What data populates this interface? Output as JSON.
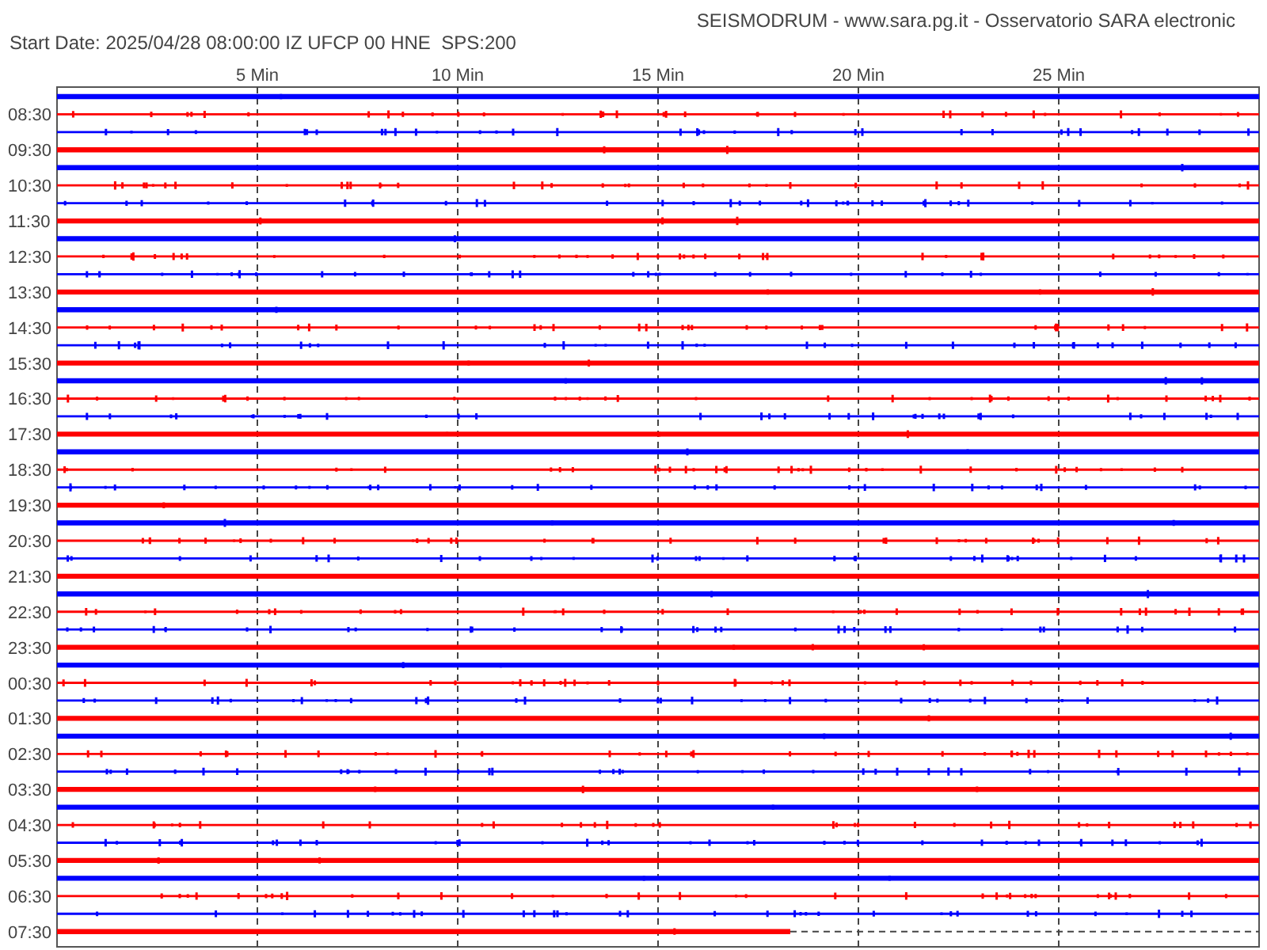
{
  "header": {
    "title": "SEISMODRUM - www.sara.pg.it - Osservatorio SARA electronic",
    "start_info": "Start Date: 2025/04/28 08:00:00 IZ UFCP 00 HNE  SPS:200"
  },
  "x_ticks": [
    "5 Min",
    "10 Min",
    "15 Min",
    "20 Min",
    "25 Min"
  ],
  "traces": [
    {
      "color": "#0000ff",
      "kind": "quiet",
      "level": 1
    },
    {
      "label": "08:30",
      "color": "#ff0000",
      "kind": "noisy",
      "level": 1
    },
    {
      "color": "#0000ff",
      "kind": "noisy",
      "level": 1
    },
    {
      "label": "09:30",
      "color": "#ff0000",
      "kind": "quiet",
      "level": 1
    },
    {
      "color": "#0000ff",
      "kind": "quiet",
      "level": 1
    },
    {
      "label": "10:30",
      "color": "#ff0000",
      "kind": "noisy",
      "level": 1
    },
    {
      "color": "#0000ff",
      "kind": "noisy",
      "level": 1
    },
    {
      "label": "11:30",
      "color": "#ff0000",
      "kind": "quiet",
      "level": 1
    },
    {
      "color": "#0000ff",
      "kind": "quiet",
      "level": 1
    },
    {
      "label": "12:30",
      "color": "#ff0000",
      "kind": "noisy",
      "level": 1
    },
    {
      "color": "#0000ff",
      "kind": "noisy",
      "level": 1
    },
    {
      "label": "13:30",
      "color": "#ff0000",
      "kind": "quiet",
      "level": 1
    },
    {
      "color": "#0000ff",
      "kind": "quiet",
      "level": 1
    },
    {
      "label": "14:30",
      "color": "#ff0000",
      "kind": "noisy",
      "level": 1
    },
    {
      "color": "#0000ff",
      "kind": "noisy",
      "level": 1
    },
    {
      "label": "15:30",
      "color": "#ff0000",
      "kind": "quiet",
      "level": 1
    },
    {
      "color": "#0000ff",
      "kind": "quiet",
      "level": 1
    },
    {
      "label": "16:30",
      "color": "#ff0000",
      "kind": "noisy",
      "level": 1
    },
    {
      "color": "#0000ff",
      "kind": "noisy",
      "level": 1
    },
    {
      "label": "17:30",
      "color": "#ff0000",
      "kind": "quiet",
      "level": 1
    },
    {
      "color": "#0000ff",
      "kind": "quiet",
      "level": 1
    },
    {
      "label": "18:30",
      "color": "#ff0000",
      "kind": "noisy",
      "level": 1
    },
    {
      "color": "#0000ff",
      "kind": "noisy",
      "level": 1
    },
    {
      "label": "19:30",
      "color": "#ff0000",
      "kind": "quiet",
      "level": 1
    },
    {
      "color": "#0000ff",
      "kind": "quiet",
      "level": 1
    },
    {
      "label": "20:30",
      "color": "#ff0000",
      "kind": "noisy",
      "level": 1
    },
    {
      "color": "#0000ff",
      "kind": "noisy",
      "level": 1
    },
    {
      "label": "21:30",
      "color": "#ff0000",
      "kind": "quiet",
      "level": 1
    },
    {
      "color": "#0000ff",
      "kind": "quiet",
      "level": 1
    },
    {
      "label": "22:30",
      "color": "#ff0000",
      "kind": "noisy",
      "level": 1
    },
    {
      "color": "#0000ff",
      "kind": "noisy",
      "level": 1
    },
    {
      "label": "23:30",
      "color": "#ff0000",
      "kind": "quiet",
      "level": 1
    },
    {
      "color": "#0000ff",
      "kind": "quiet",
      "level": 1
    },
    {
      "label": "00:30",
      "color": "#ff0000",
      "kind": "noisy",
      "level": 1
    },
    {
      "color": "#0000ff",
      "kind": "noisy",
      "level": 1
    },
    {
      "label": "01:30",
      "color": "#ff0000",
      "kind": "quiet",
      "level": 1
    },
    {
      "color": "#0000ff",
      "kind": "quiet",
      "level": 1
    },
    {
      "label": "02:30",
      "color": "#ff0000",
      "kind": "noisy",
      "level": 1
    },
    {
      "color": "#0000ff",
      "kind": "noisy",
      "level": 1
    },
    {
      "label": "03:30",
      "color": "#ff0000",
      "kind": "quiet",
      "level": 1
    },
    {
      "color": "#0000ff",
      "kind": "quiet",
      "level": 1
    },
    {
      "label": "04:30",
      "color": "#ff0000",
      "kind": "noisy",
      "level": 1
    },
    {
      "color": "#0000ff",
      "kind": "noisy",
      "level": 1
    },
    {
      "label": "05:30",
      "color": "#ff0000",
      "kind": "quiet",
      "level": 1
    },
    {
      "color": "#0000ff",
      "kind": "quiet",
      "level": 1
    },
    {
      "label": "06:30",
      "color": "#ff0000",
      "kind": "noisy",
      "level": 1
    },
    {
      "color": "#0000ff",
      "kind": "noisy",
      "level": 1
    },
    {
      "label": "07:30",
      "color": "#ff0000",
      "kind": "quiet",
      "level": 0.61
    }
  ]
}
